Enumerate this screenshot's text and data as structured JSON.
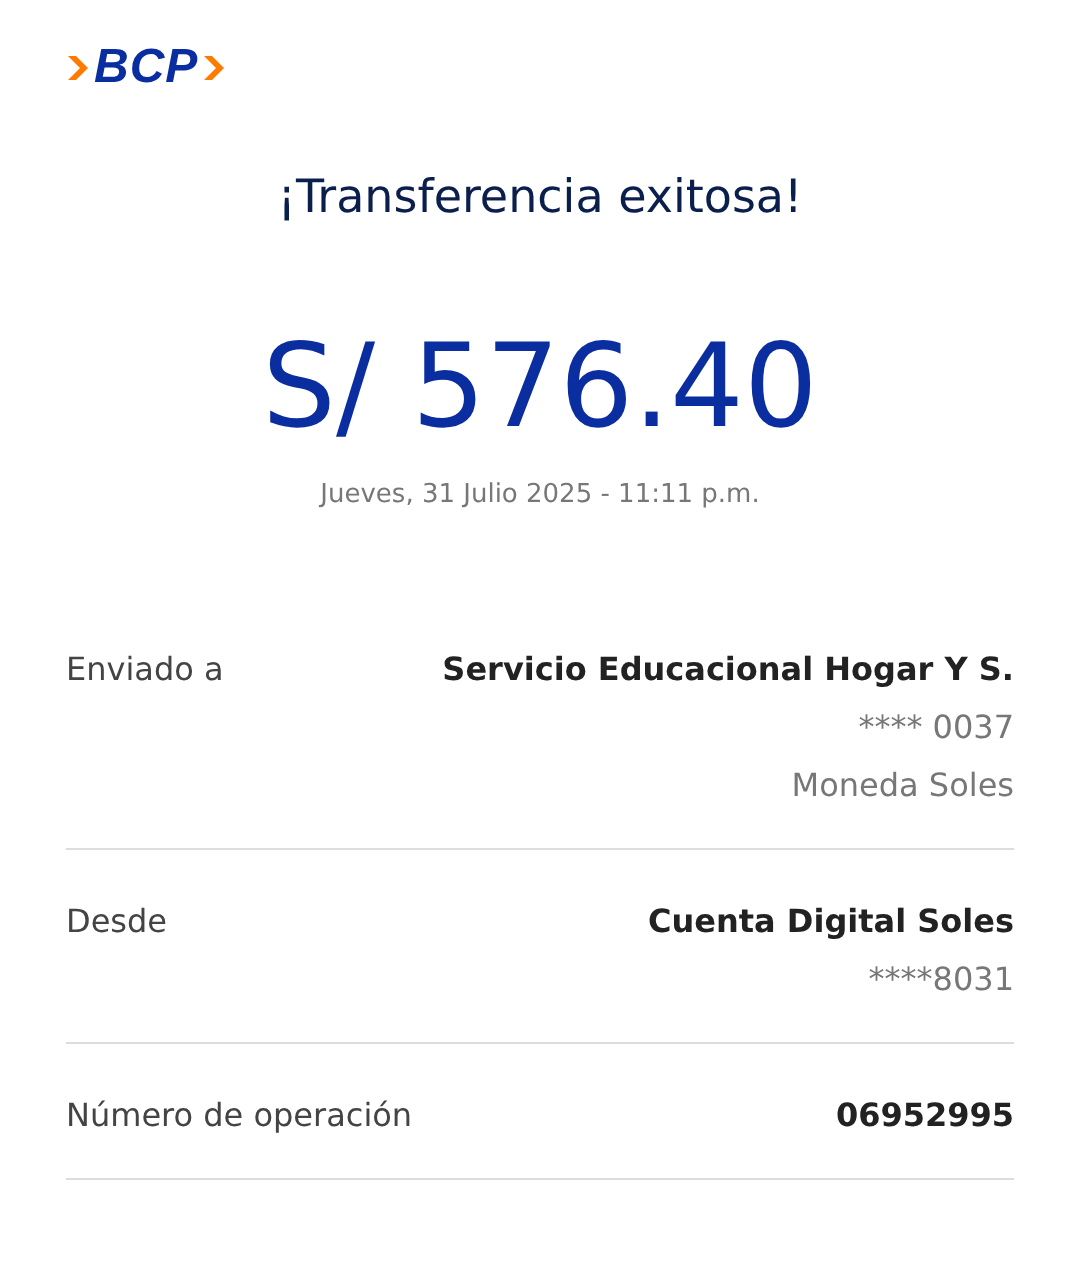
{
  "logo": {
    "text": "BCP"
  },
  "title": "¡Transferencia exitosa!",
  "amount": "S/ 576.40",
  "date": "Jueves, 31 Julio 2025 - 11:11 p.m.",
  "details": [
    {
      "label": "Enviado a",
      "values": [
        "Servicio Educacional Hogar Y S.",
        "**** 0037",
        "Moneda Soles"
      ]
    },
    {
      "label": "Desde",
      "values": [
        "Cuenta Digital Soles",
        "****8031"
      ]
    },
    {
      "label": "Número de operación",
      "values": [
        "06952995"
      ]
    }
  ]
}
